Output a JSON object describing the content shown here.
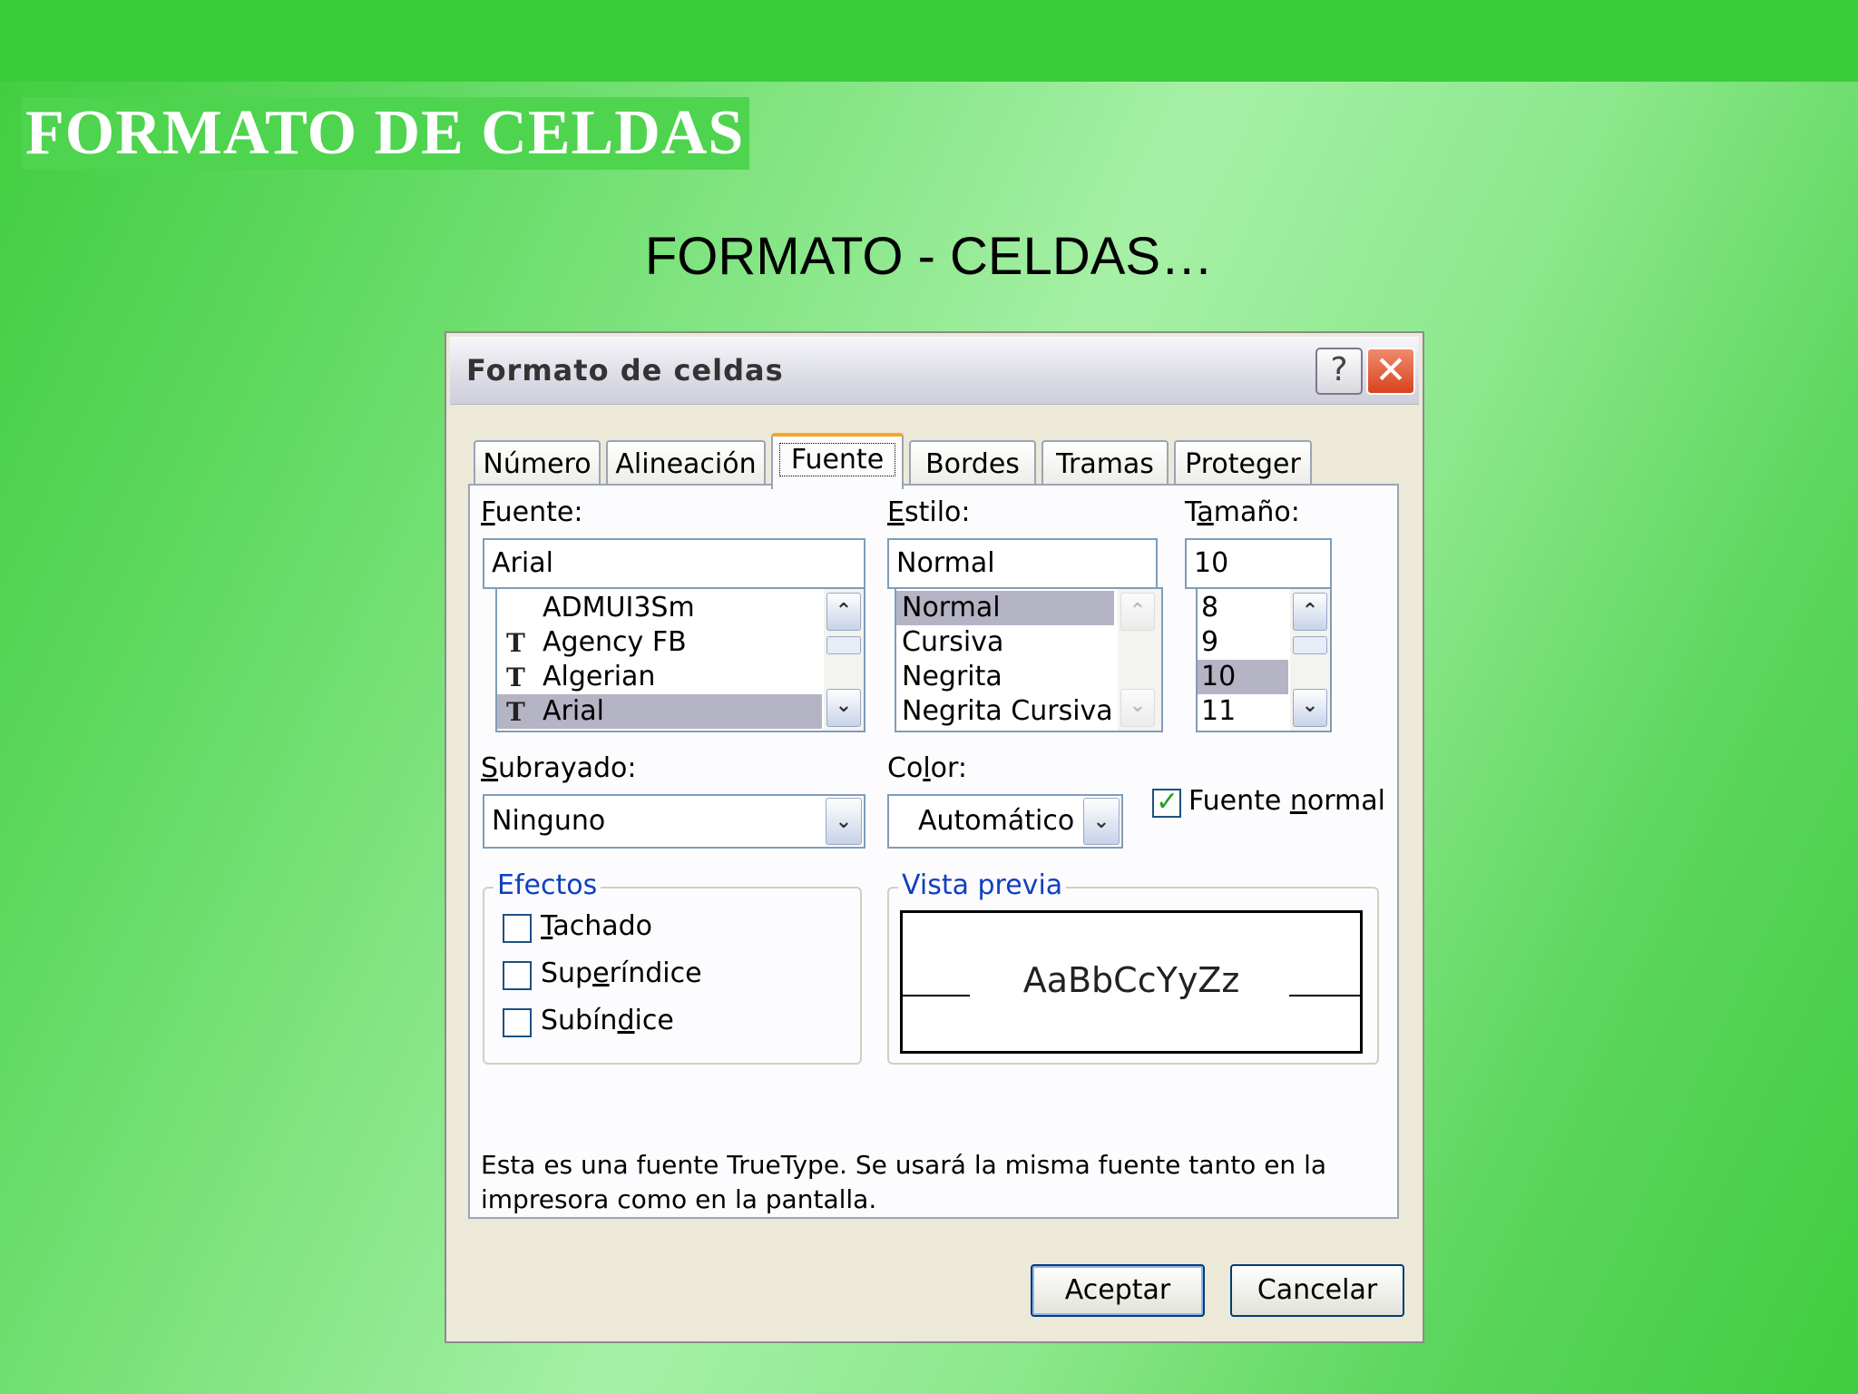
{
  "slide": {
    "title": "FORMATO DE CELDAS",
    "subtitle": "FORMATO - CELDAS…"
  },
  "dialog": {
    "title": "Formato de celdas",
    "help_label": "?",
    "close_label": "✕",
    "tabs": [
      {
        "label": "Número",
        "active": false
      },
      {
        "label": "Alineación",
        "active": false
      },
      {
        "label": "Fuente",
        "active": true
      },
      {
        "label": "Bordes",
        "active": false
      },
      {
        "label": "Tramas",
        "active": false
      },
      {
        "label": "Proteger",
        "active": false
      }
    ],
    "fuente": {
      "label_first": "F",
      "label_rest": "uente:",
      "value": "Arial",
      "items": [
        {
          "label": "ADMUI3Sm",
          "truetype": false,
          "selected": false
        },
        {
          "label": "Agency FB",
          "truetype": true,
          "selected": false
        },
        {
          "label": "Algerian",
          "truetype": true,
          "selected": false
        },
        {
          "label": "Arial",
          "truetype": true,
          "selected": true
        }
      ]
    },
    "estilo": {
      "label_first": "E",
      "label_rest": "stilo:",
      "value": "Normal",
      "items": [
        {
          "label": "Normal",
          "selected": true
        },
        {
          "label": "Cursiva",
          "selected": false
        },
        {
          "label": "Negrita",
          "selected": false
        },
        {
          "label": "Negrita Cursiva",
          "selected": false
        }
      ]
    },
    "tamano": {
      "label_pre": "T",
      "label_u": "a",
      "label_post": "maño:",
      "value": "10",
      "items": [
        {
          "label": "8",
          "selected": false
        },
        {
          "label": "9",
          "selected": false
        },
        {
          "label": "10",
          "selected": true
        },
        {
          "label": "11",
          "selected": false
        }
      ]
    },
    "subrayado": {
      "label_first": "S",
      "label_rest": "ubrayado:",
      "value": "Ninguno"
    },
    "color": {
      "label_pre": "Co",
      "label_u": "l",
      "label_post": "or:",
      "value": "Automático"
    },
    "fuente_normal": {
      "label_pre": "Fuente ",
      "label_u": "n",
      "label_post": "ormal",
      "checked": true
    },
    "efectos": {
      "title": "Efectos",
      "items": [
        {
          "pre": "",
          "u": "T",
          "post": "achado",
          "checked": false
        },
        {
          "pre": "Sup",
          "u": "e",
          "post": "ríndice",
          "checked": false
        },
        {
          "pre": "Subín",
          "u": "d",
          "post": "ice",
          "checked": false
        }
      ]
    },
    "vista_previa": {
      "title": "Vista previa",
      "sample": "AaBbCcYyZz"
    },
    "info": "Esta es una fuente TrueType. Se usará la misma fuente tanto en la impresora como en la pantalla.",
    "accept_label": "Aceptar",
    "cancel_label": "Cancelar"
  },
  "icons": {
    "truetype": "truetype-icon",
    "up": "arrow-up-icon",
    "down": "arrow-down-icon",
    "checkmark": "checkmark-icon"
  },
  "colors": {
    "slide_green": "#3acc3a",
    "dialog_bg": "#ece9d8",
    "selection": "#b4b4c4",
    "group_title": "#1040c0",
    "close_red": "#d8431f"
  }
}
